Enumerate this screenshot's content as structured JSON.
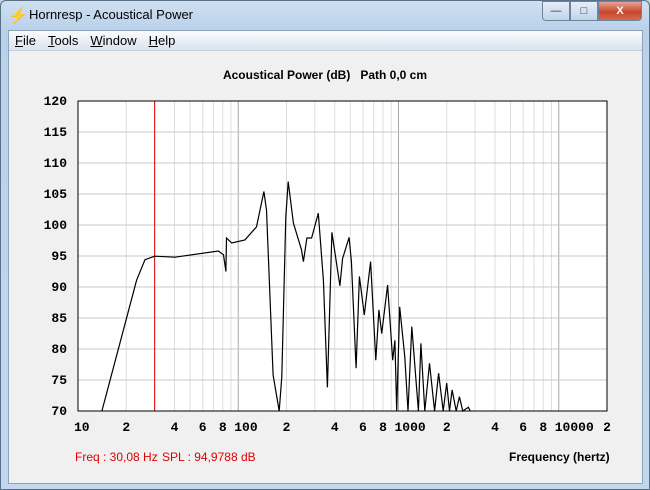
{
  "window": {
    "title": "Hornresp - Acoustical Power",
    "minimize": "—",
    "maximize": "□",
    "close": "X"
  },
  "menu": [
    {
      "label": "File",
      "key": "F",
      "rest": "ile"
    },
    {
      "label": "Tools",
      "key": "T",
      "rest": "ools"
    },
    {
      "label": "Window",
      "key": "W",
      "rest": "indow"
    },
    {
      "label": "Help",
      "key": "H",
      "rest": "elp"
    }
  ],
  "readout": {
    "freq": "Freq : 30,08 Hz",
    "spl": "SPL : 94,9788 dB"
  },
  "colors": {
    "curve": "#000000",
    "cursor": "#e00000",
    "grid": "#c8c8c8",
    "grid_major": "#a8a8a8"
  },
  "chart_data": {
    "type": "line",
    "title": "Acoustical Power (dB)   Path 0,0 cm",
    "xlabel": "Frequency (hertz)",
    "ylabel": "",
    "xscale": "log",
    "xlim": [
      10,
      20000
    ],
    "ylim": [
      70,
      120
    ],
    "grid": true,
    "yticks": [
      120,
      115,
      110,
      105,
      100,
      95,
      90,
      85,
      80,
      75,
      70
    ],
    "xticks": [
      {
        "v": 10,
        "l": "10"
      },
      {
        "v": 20,
        "l": "2"
      },
      {
        "v": 40,
        "l": "4"
      },
      {
        "v": 60,
        "l": "6"
      },
      {
        "v": 80,
        "l": "8"
      },
      {
        "v": 100,
        "l": "100"
      },
      {
        "v": 200,
        "l": "2"
      },
      {
        "v": 400,
        "l": "4"
      },
      {
        "v": 600,
        "l": "6"
      },
      {
        "v": 800,
        "l": "8"
      },
      {
        "v": 1000,
        "l": "1000"
      },
      {
        "v": 2000,
        "l": "2"
      },
      {
        "v": 4000,
        "l": "4"
      },
      {
        "v": 6000,
        "l": "6"
      },
      {
        "v": 8000,
        "l": "8"
      },
      {
        "v": 10000,
        "l": "10000"
      },
      {
        "v": 20000,
        "l": "2"
      }
    ],
    "cursor": {
      "freq": 30.08,
      "spl": 94.9788
    },
    "series": [
      {
        "name": "Acoustical Power",
        "points": [
          [
            14.1,
            70
          ],
          [
            23.2,
            91.1
          ],
          [
            26.2,
            94.4
          ],
          [
            30.1,
            94.97
          ],
          [
            40.3,
            94.8
          ],
          [
            75.1,
            95.8
          ],
          [
            80.9,
            95.2
          ],
          [
            83.7,
            92.5
          ],
          [
            84.5,
            97.9
          ],
          [
            91,
            97.1
          ],
          [
            110,
            97.6
          ],
          [
            130,
            99.7
          ],
          [
            144.5,
            105.4
          ],
          [
            150,
            102.4
          ],
          [
            165,
            75.8
          ],
          [
            180,
            70
          ],
          [
            187,
            75.5
          ],
          [
            198,
            101.3
          ],
          [
            205,
            107
          ],
          [
            221,
            100.3
          ],
          [
            248,
            96
          ],
          [
            255,
            94.1
          ],
          [
            268,
            97.9
          ],
          [
            287,
            97.9
          ],
          [
            316,
            101.9
          ],
          [
            340,
            91.1
          ],
          [
            360,
            73.8
          ],
          [
            384,
            98.8
          ],
          [
            431,
            90.2
          ],
          [
            448,
            94.6
          ],
          [
            492,
            98
          ],
          [
            508,
            94.1
          ],
          [
            544,
            76.9
          ],
          [
            570,
            91.7
          ],
          [
            612,
            85.5
          ],
          [
            670,
            94.1
          ],
          [
            722,
            78.2
          ],
          [
            755,
            86.3
          ],
          [
            785,
            82.5
          ],
          [
            855,
            90.3
          ],
          [
            920,
            78.2
          ],
          [
            950,
            81.4
          ],
          [
            975,
            70
          ],
          [
            1017,
            86.8
          ],
          [
            1094,
            78.7
          ],
          [
            1146,
            70
          ],
          [
            1210,
            83.6
          ],
          [
            1330,
            70
          ],
          [
            1380,
            80.9
          ],
          [
            1460,
            70
          ],
          [
            1560,
            77.7
          ],
          [
            1680,
            70
          ],
          [
            1780,
            76.1
          ],
          [
            1900,
            70
          ],
          [
            2000,
            74.5
          ],
          [
            2080,
            70
          ],
          [
            2160,
            73.4
          ],
          [
            2290,
            70
          ],
          [
            2400,
            72.3
          ],
          [
            2520,
            70
          ],
          [
            2730,
            70.6
          ],
          [
            2800,
            70
          ]
        ]
      }
    ]
  }
}
